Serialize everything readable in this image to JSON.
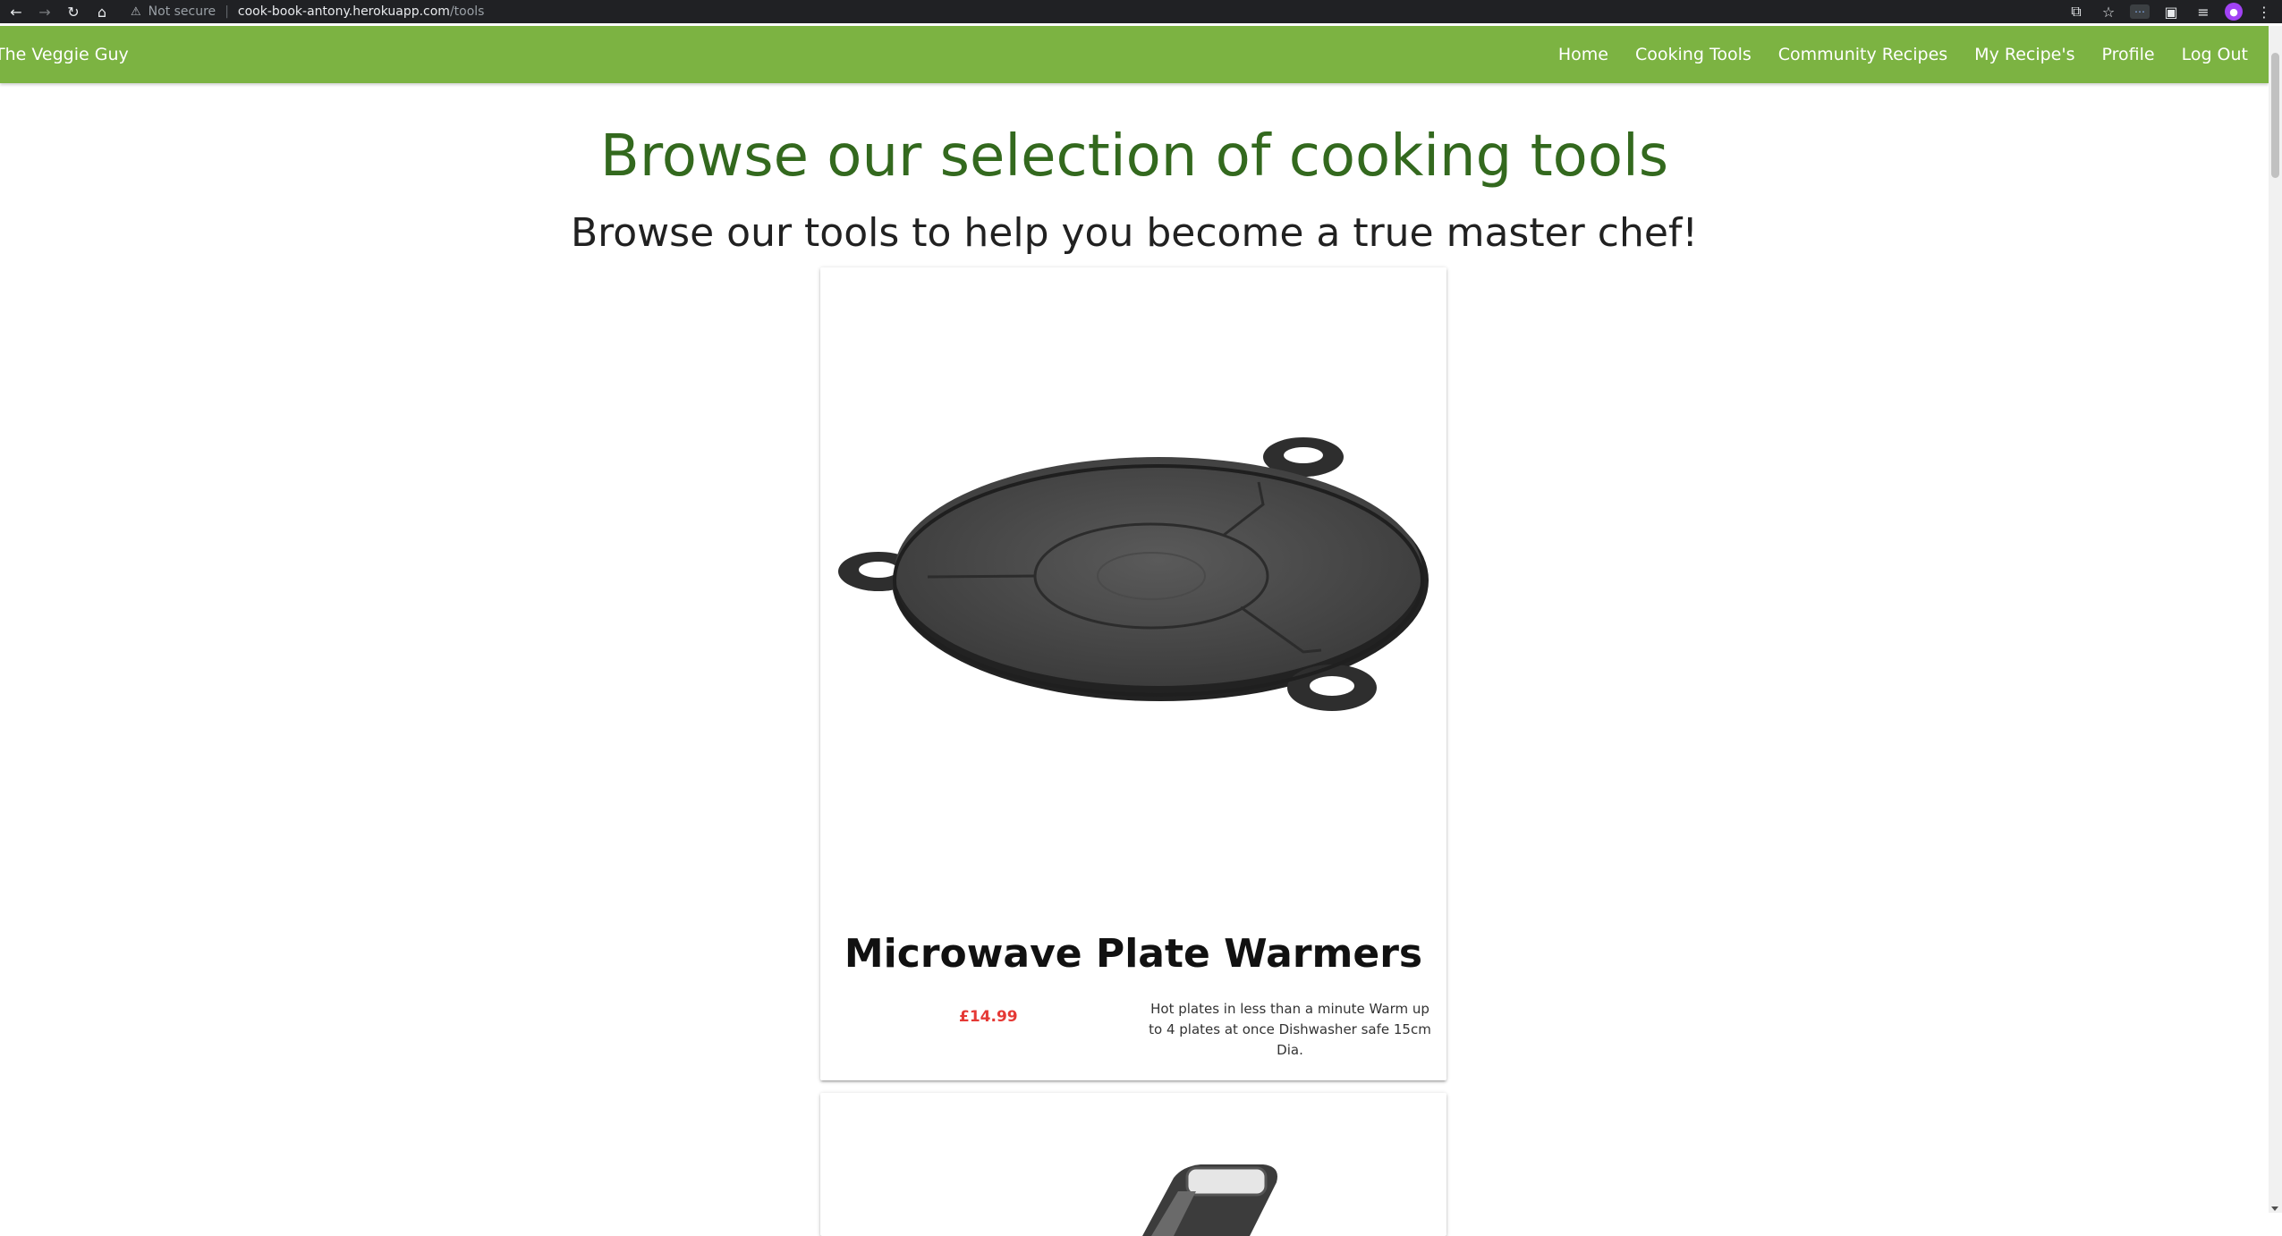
{
  "browser": {
    "security_label": "Not secure",
    "url_host": "cook-book-antony.herokuapp.com",
    "url_path": "/tools"
  },
  "nav": {
    "brand": "The Veggie Guy",
    "links": [
      {
        "label": "Home"
      },
      {
        "label": "Cooking Tools"
      },
      {
        "label": "Community Recipes"
      },
      {
        "label": "My Recipe's"
      },
      {
        "label": "Profile"
      },
      {
        "label": "Log Out"
      }
    ],
    "bar_color": "#7cb342"
  },
  "main": {
    "title": "Browse our selection of cooking tools",
    "subtitle": "Browse our tools to help you become a true master chef!",
    "title_color": "#33691e"
  },
  "tools": [
    {
      "name": "Microwave Plate Warmers",
      "price": "£14.99",
      "description": "Hot plates in less than a minute Warm up to 4 plates at once Dishwasher safe 15cm Dia.",
      "image": "plate-warmer-image"
    },
    {
      "name": "",
      "image": "kitchen-utensil-image"
    }
  ],
  "colors": {
    "price": "#e53935"
  }
}
